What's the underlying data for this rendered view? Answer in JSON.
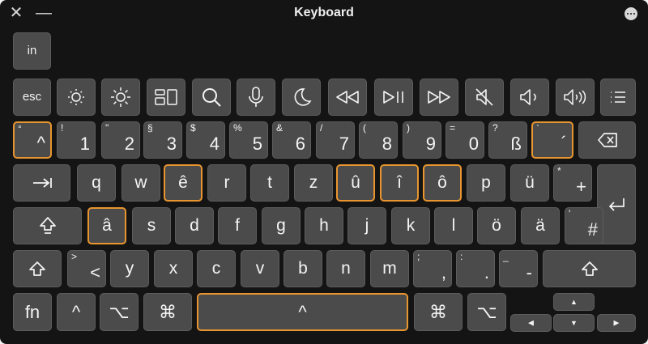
{
  "window": {
    "title": "Keyboard",
    "close": "✕",
    "minimize": "—"
  },
  "keys": {
    "input_source": "in",
    "esc": "esc",
    "num": [
      {
        "s": "°",
        "m": "^"
      },
      {
        "s": "!",
        "m": "1"
      },
      {
        "s": "\"",
        "m": "2"
      },
      {
        "s": "§",
        "m": "3"
      },
      {
        "s": "$",
        "m": "4"
      },
      {
        "s": "%",
        "m": "5"
      },
      {
        "s": "&",
        "m": "6"
      },
      {
        "s": "/",
        "m": "7"
      },
      {
        "s": "(",
        "m": "8"
      },
      {
        "s": ")",
        "m": "9"
      },
      {
        "s": "=",
        "m": "0"
      },
      {
        "s": "?",
        "m": "ß"
      },
      {
        "s": "`",
        "m": "´"
      }
    ],
    "qrow": [
      "q",
      "w",
      "ê",
      "r",
      "t",
      "z",
      "û",
      "î",
      "ô",
      "p",
      "ü"
    ],
    "plus": {
      "s": "*",
      "m": "+"
    },
    "arow": [
      "â",
      "s",
      "d",
      "f",
      "g",
      "h",
      "j",
      "k",
      "l",
      "ö",
      "ä"
    ],
    "hash": {
      "s": "'",
      "m": "#"
    },
    "zrow": [
      "y",
      "x",
      "c",
      "v",
      "b",
      "n",
      "m"
    ],
    "lt": {
      "s": ">",
      "m": "<"
    },
    "comma": {
      "s": ";",
      "m": ","
    },
    "period": {
      "s": ":",
      "m": "."
    },
    "dash": {
      "s": "_",
      "m": "-"
    },
    "fn": "fn",
    "ctrl": "^",
    "option": "⌥",
    "command": "⌘",
    "space": "^",
    "arrows": {
      "up": "▲",
      "left": "◀",
      "down": "▼",
      "right": "▶"
    }
  },
  "colors": {
    "background": "#141414",
    "key": "#4b4b4b",
    "highlight": "#e8952f",
    "text": "#f4f4f4"
  }
}
